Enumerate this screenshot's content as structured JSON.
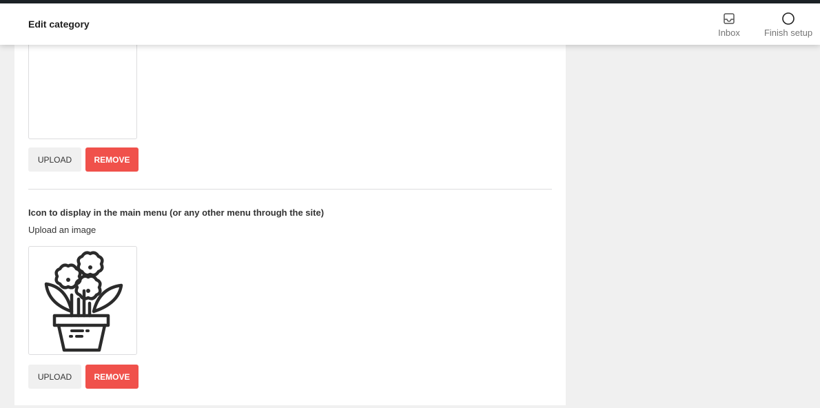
{
  "header": {
    "title": "Edit category",
    "actions": [
      {
        "label": "Inbox",
        "icon": "inbox-icon"
      },
      {
        "label": "Finish setup",
        "icon": "circle-progress-icon"
      }
    ]
  },
  "section_top": {
    "upload_label": "UPLOAD",
    "remove_label": "REMOVE"
  },
  "menu_icon_section": {
    "label": "Icon to display in the main menu (or any other menu through the site)",
    "help": "Upload an image",
    "image_icon": "flower-pot-icon",
    "upload_label": "UPLOAD",
    "remove_label": "REMOVE"
  },
  "colors": {
    "remove": "#f0514b",
    "upload": "#f0f0f0"
  }
}
